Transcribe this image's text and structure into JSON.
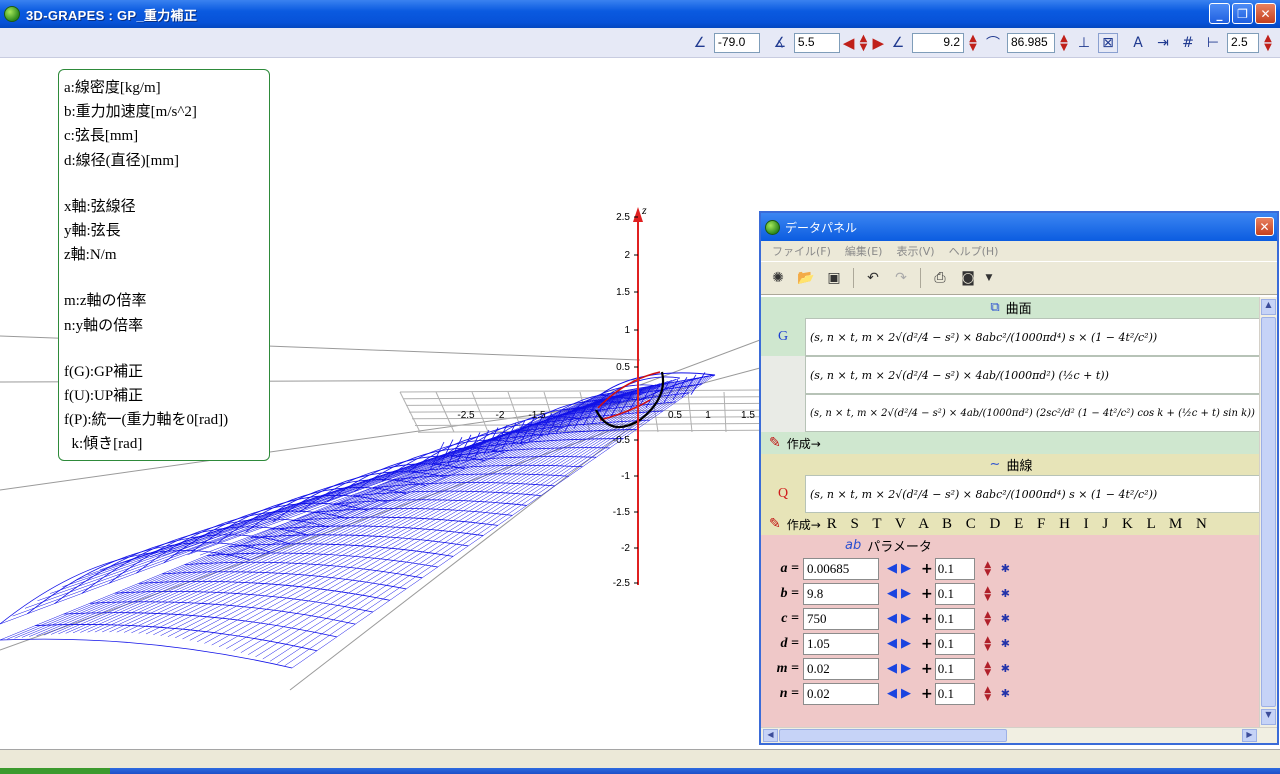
{
  "window": {
    "title": "3D-GRAPES : GP_重力補正",
    "min": "_",
    "max": "❐",
    "close": "✕"
  },
  "toolbar": {
    "rot1": "-79.0",
    "rot2": "5.5",
    "rot3": "9.2",
    "angle": "86.985",
    "scale": "2.5"
  },
  "legend": {
    "lines_a": [
      "a:線密度[kg/m]",
      "b:重力加速度[m/s^2]",
      "c:弦長[mm]",
      "d:線径(直径)[mm]"
    ],
    "lines_b": [
      "x軸:弦線径",
      "y軸:弦長",
      "z軸:N/m"
    ],
    "lines_c": [
      "m:z軸の倍率",
      "n:y軸の倍率"
    ],
    "lines_d": [
      "f(G):GP補正",
      "f(U):UP補正",
      "f(P):統一(重力軸を0[rad])",
      "  k:傾き[rad]"
    ]
  },
  "axis": {
    "z_label": "z",
    "z_ticks": [
      "2.5",
      "2",
      "1.5",
      "1",
      "0.5",
      "-0.5",
      "-1",
      "-1.5",
      "-2",
      "-2.5"
    ],
    "x_ticks": [
      "-2.5",
      "-2",
      "-1.5",
      "0.5",
      "1",
      "1.5"
    ]
  },
  "panel": {
    "title": "データパネル",
    "menus": [
      "ファイル(F)",
      "編集(E)",
      "表示(V)",
      "ヘルプ(H)"
    ],
    "surface_head": "曲面",
    "surfaces": [
      {
        "label": "G",
        "formula": "(s, n × t, m × 2√(d²/4 − s²) × 8abc²/(1000πd⁴) s × (1 − 4t²/c²))"
      },
      {
        "label": "",
        "formula": "(s, n × t, m × 2√(d²/4 − s²) × 4ab/(1000πd²) (½c + t))"
      },
      {
        "label": "",
        "formula": "(s, n × t, m × 2√(d²/4 − s²) × 4ab/(1000πd²) (2sc²/d² (1 − 4t²/c²) cos k + (½c + t) sin k))"
      }
    ],
    "create_label": "作成→",
    "curve_head": "曲線",
    "curves": [
      {
        "label": "Q",
        "formula": "(s, n × t, m × 2√(d²/4 − s²) × 8abc²/(1000πd⁴) s × (1 − 4t²/c²))"
      }
    ],
    "curve_letters": "R S T V A B C D E F H I J K L M N",
    "param_head": "パラメータ",
    "params": [
      {
        "name": "a =",
        "value": "0.00685",
        "step": "0.1"
      },
      {
        "name": "b =",
        "value": "9.8",
        "step": "0.1"
      },
      {
        "name": "c =",
        "value": "750",
        "step": "0.1"
      },
      {
        "name": "d =",
        "value": "1.05",
        "step": "0.1"
      },
      {
        "name": "m =",
        "value": "0.02",
        "step": "0.1"
      },
      {
        "name": "n =",
        "value": "0.02",
        "step": "0.1"
      }
    ]
  }
}
